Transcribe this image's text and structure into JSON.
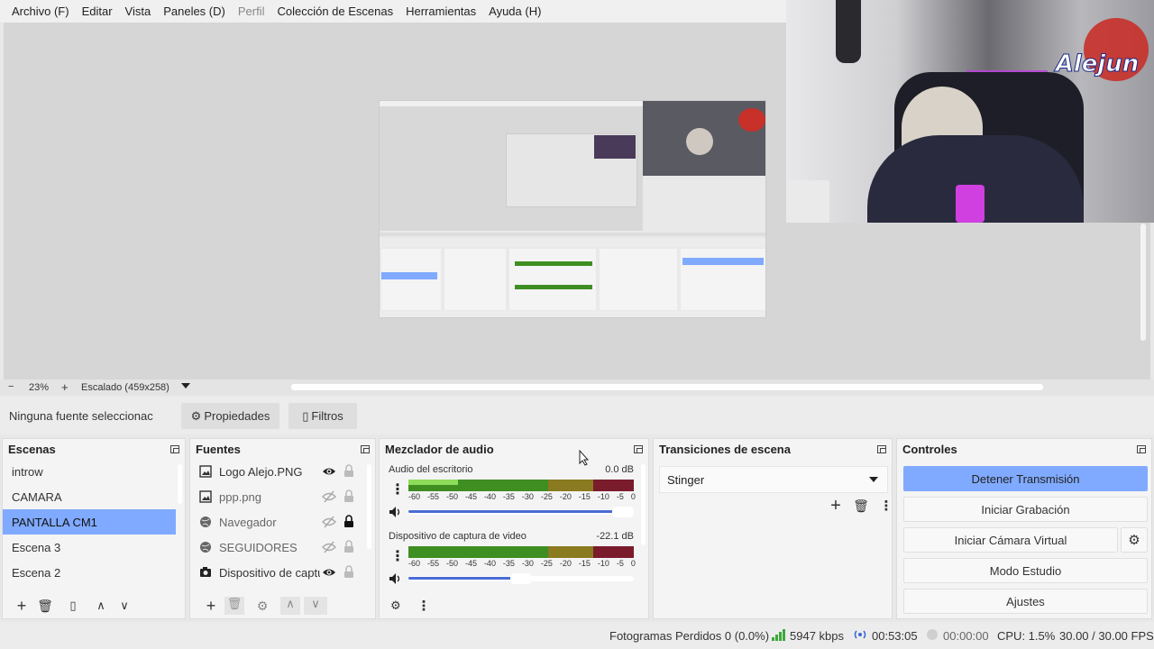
{
  "menubar": [
    "Archivo (F)",
    "Editar",
    "Vista",
    "Paneles (D)",
    "Perfil",
    "Colección de Escenas",
    "Herramientas",
    "Ayuda (H)"
  ],
  "webcam_logo_text": "Alejun",
  "zoombar": {
    "minus": "−",
    "zoom": "23%",
    "plus": "+",
    "scaling": "Escalado (459x258)"
  },
  "properties_bar": {
    "no_source": "Ninguna fuente seleccionac",
    "properties": "Propiedades",
    "filters": "Filtros"
  },
  "scenes": {
    "title": "Escenas",
    "items": [
      "introw",
      "CAMARA",
      "PANTALLA CM1",
      "Escena 3",
      "Escena 2"
    ],
    "active_index": 2
  },
  "sources": {
    "title": "Fuentes",
    "items": [
      {
        "name": "Logo Alejo.PNG",
        "icon": "image-icon",
        "visible": true,
        "locked": false
      },
      {
        "name": "ppp.png",
        "icon": "image-icon",
        "visible": false,
        "locked": false
      },
      {
        "name": "Navegador",
        "icon": "globe-icon",
        "visible": false,
        "locked": true
      },
      {
        "name": "SEGUIDORES",
        "icon": "globe-icon",
        "visible": false,
        "locked": false
      },
      {
        "name": "Dispositivo de captu",
        "icon": "camera-icon",
        "visible": true,
        "locked": false
      }
    ]
  },
  "mixer": {
    "title": "Mezclador de audio",
    "channels": [
      {
        "name": "Audio del escritorio",
        "db": "0.0 dB",
        "level": 0.22,
        "volume": 0.95
      },
      {
        "name": "Dispositivo de captura de video",
        "db": "-22.1 dB",
        "level": 0.0,
        "volume": 0.5
      }
    ],
    "ticks": [
      "-60",
      "-55",
      "-50",
      "-45",
      "-40",
      "-35",
      "-30",
      "-25",
      "-20",
      "-15",
      "-10",
      "-5",
      "0"
    ]
  },
  "transitions": {
    "title": "Transiciones de escena",
    "selected": "Stinger"
  },
  "controls": {
    "title": "Controles",
    "stop_stream": "Detener Transmisión",
    "start_recording": "Iniciar Grabación",
    "virtual_cam": "Iniciar Cámara Virtual",
    "studio_mode": "Modo Estudio",
    "settings": "Ajustes"
  },
  "status": {
    "dropped": "Fotogramas Perdidos 0 (0.0%)",
    "kbps": "5947 kbps",
    "stream_time": "00:53:05",
    "rec_time": "00:00:00",
    "cpu": "CPU: 1.5%",
    "fps": "30.00 / 30.00 FPS"
  },
  "colors": {
    "accent": "#80aaff",
    "meter_green": "#3e8e22",
    "meter_yellow": "#8a7a20",
    "meter_red": "#7a1c2c",
    "volume": "#4a6cd4"
  }
}
